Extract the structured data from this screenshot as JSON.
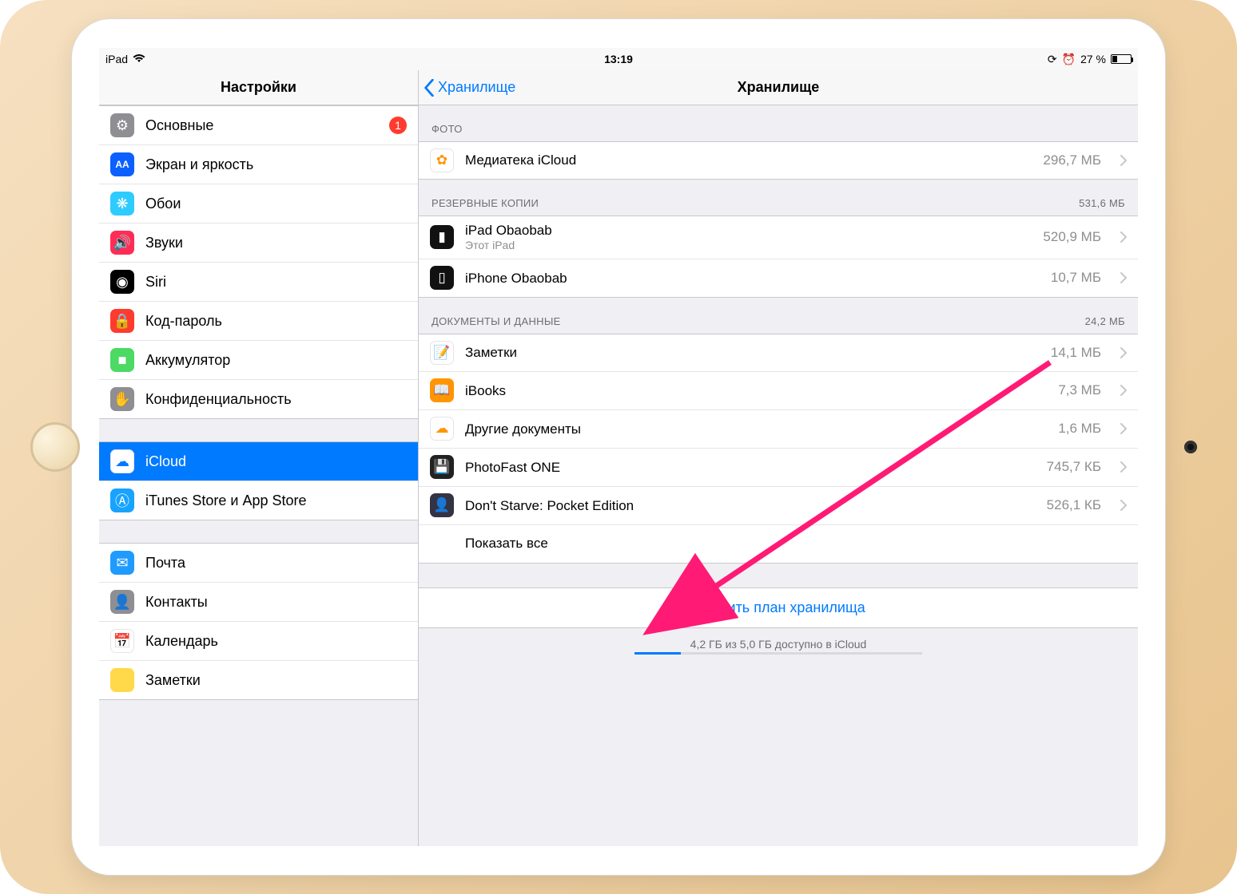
{
  "status": {
    "device": "iPad",
    "time": "13:19",
    "battery_pct": "27 %"
  },
  "left": {
    "title": "Настройки",
    "groups": [
      {
        "items": [
          {
            "id": "general",
            "label": "Основные",
            "icon_bg": "#8e8e93",
            "icon": "⚙︎",
            "badge": "1"
          },
          {
            "id": "display",
            "label": "Экран и яркость",
            "icon_bg": "#0b60ff",
            "icon": "AA"
          },
          {
            "id": "wallpaper",
            "label": "Обои",
            "icon_bg": "#2ecbff",
            "icon": "❋"
          },
          {
            "id": "sounds",
            "label": "Звуки",
            "icon_bg": "#ff2d55",
            "icon": "🔊"
          },
          {
            "id": "siri",
            "label": "Siri",
            "icon_bg": "#000000",
            "icon": "◉"
          },
          {
            "id": "passcode",
            "label": "Код-пароль",
            "icon_bg": "#ff3b30",
            "icon": "🔒"
          },
          {
            "id": "battery",
            "label": "Аккумулятор",
            "icon_bg": "#4cd964",
            "icon": "■"
          },
          {
            "id": "privacy",
            "label": "Конфиденциальность",
            "icon_bg": "#8e8e93",
            "icon": "✋"
          }
        ]
      },
      {
        "items": [
          {
            "id": "icloud",
            "label": "iCloud",
            "sub": "",
            "icon_bg": "#ffffff",
            "icon": "☁︎",
            "selected": true
          },
          {
            "id": "itunes",
            "label": "iTunes Store и App Store",
            "icon_bg": "#18a3ff",
            "icon": "Ⓐ"
          }
        ]
      },
      {
        "items": [
          {
            "id": "mail",
            "label": "Почта",
            "icon_bg": "#1f9bff",
            "icon": "✉︎"
          },
          {
            "id": "contacts",
            "label": "Контакты",
            "icon_bg": "#8e8e93",
            "icon": "👤"
          },
          {
            "id": "calendar",
            "label": "Календарь",
            "icon_bg": "#ffffff",
            "icon": "📅"
          },
          {
            "id": "notes",
            "label": "Заметки",
            "icon_bg": "#ffd94a",
            "icon": ""
          }
        ]
      }
    ]
  },
  "right": {
    "back_label": "Хранилище",
    "title": "Хранилище",
    "sections": [
      {
        "header": "ФОТО",
        "header_val": "",
        "rows": [
          {
            "id": "photolib",
            "title": "Медиатека iCloud",
            "size": "296,7 МБ",
            "icon_bg": "#ffffff",
            "icon": "✿"
          }
        ]
      },
      {
        "header": "РЕЗЕРВНЫЕ КОПИИ",
        "header_val": "531,6 МБ",
        "rows": [
          {
            "id": "ipad-backup",
            "title": "iPad Obaobab",
            "sub": "Этот iPad",
            "size": "520,9 МБ",
            "icon_bg": "#111",
            "icon": "▮"
          },
          {
            "id": "iphone-backup",
            "title": "iPhone Obaobab",
            "size": "10,7 МБ",
            "icon_bg": "#111",
            "icon": "▯"
          }
        ]
      },
      {
        "header": "ДОКУМЕНТЫ И ДАННЫЕ",
        "header_val": "24,2 МБ",
        "rows": [
          {
            "id": "notes-app",
            "title": "Заметки",
            "size": "14,1 МБ",
            "icon_bg": "#fff",
            "icon": "📝"
          },
          {
            "id": "ibooks",
            "title": "iBooks",
            "size": "7,3 МБ",
            "icon_bg": "#ff9500",
            "icon": "📖"
          },
          {
            "id": "other-docs",
            "title": "Другие документы",
            "size": "1,6 МБ",
            "icon_bg": "#fff",
            "icon": "☁︎"
          },
          {
            "id": "photofast",
            "title": "PhotoFast ONE",
            "size": "745,7 КБ",
            "icon_bg": "#222",
            "icon": "💾"
          },
          {
            "id": "dontstarve",
            "title": "Don't Starve: Pocket Edition",
            "size": "526,1 КБ",
            "icon_bg": "#334",
            "icon": "👤"
          }
        ],
        "show_all": "Показать все"
      }
    ],
    "change_plan": "Сменить план хранилища",
    "footer": "4,2 ГБ из 5,0 ГБ доступно в iCloud"
  }
}
